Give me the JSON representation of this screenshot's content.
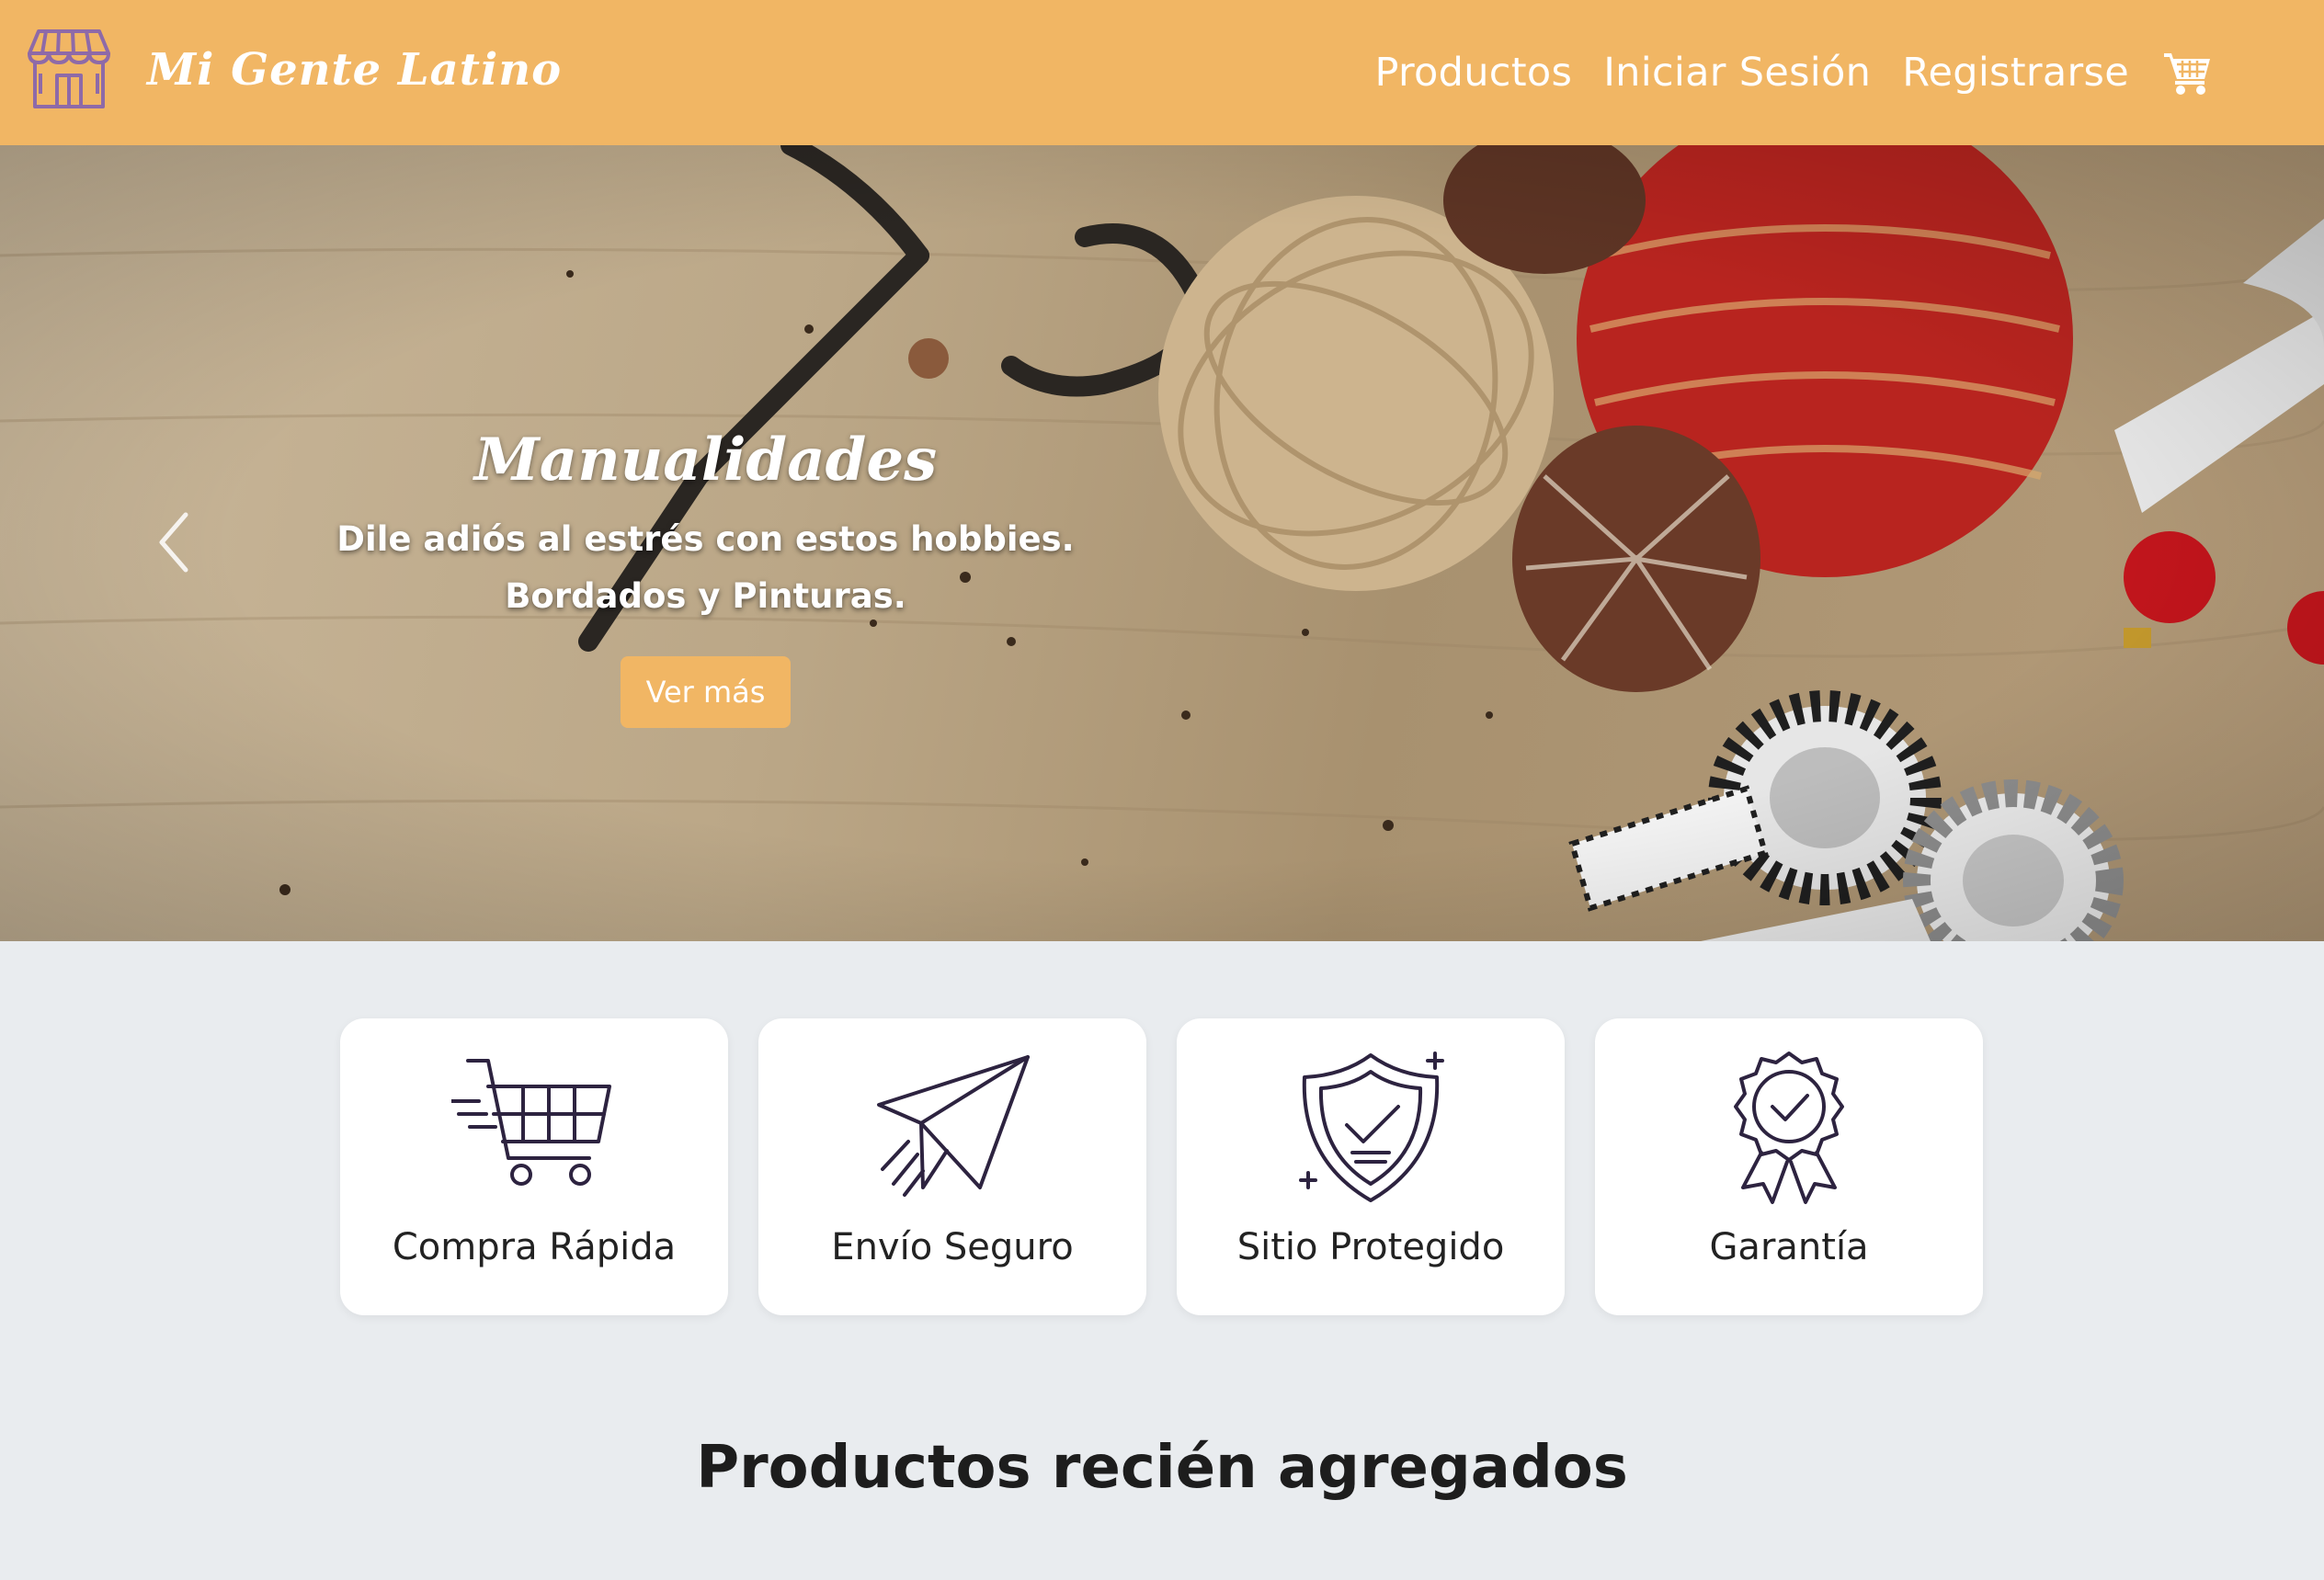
{
  "brand": {
    "name": "Mi Gente Latino",
    "icon": "storefront-icon"
  },
  "nav": {
    "links": [
      "Productos",
      "Iniciar Sesión",
      "Registrarse"
    ],
    "cart_icon": "cart-icon"
  },
  "hero": {
    "title": "Manualidades",
    "line1": "Dile adiós al estrés con estos hobbies.",
    "line2": "Bordados y Pinturas.",
    "button": "Ver más",
    "prev_icon": "chevron-left-icon"
  },
  "features": [
    {
      "label": "Compra Rápida",
      "icon": "fast-cart-icon"
    },
    {
      "label": "Envío Seguro",
      "icon": "paper-plane-icon"
    },
    {
      "label": "Sitio Protegido",
      "icon": "shield-check-icon"
    },
    {
      "label": "Garantía",
      "icon": "award-badge-icon"
    }
  ],
  "section": {
    "title": "Productos recién agregados"
  },
  "colors": {
    "accent": "#f1b664",
    "background": "#e9ecef",
    "brand_icon": "#8e6aa8"
  }
}
